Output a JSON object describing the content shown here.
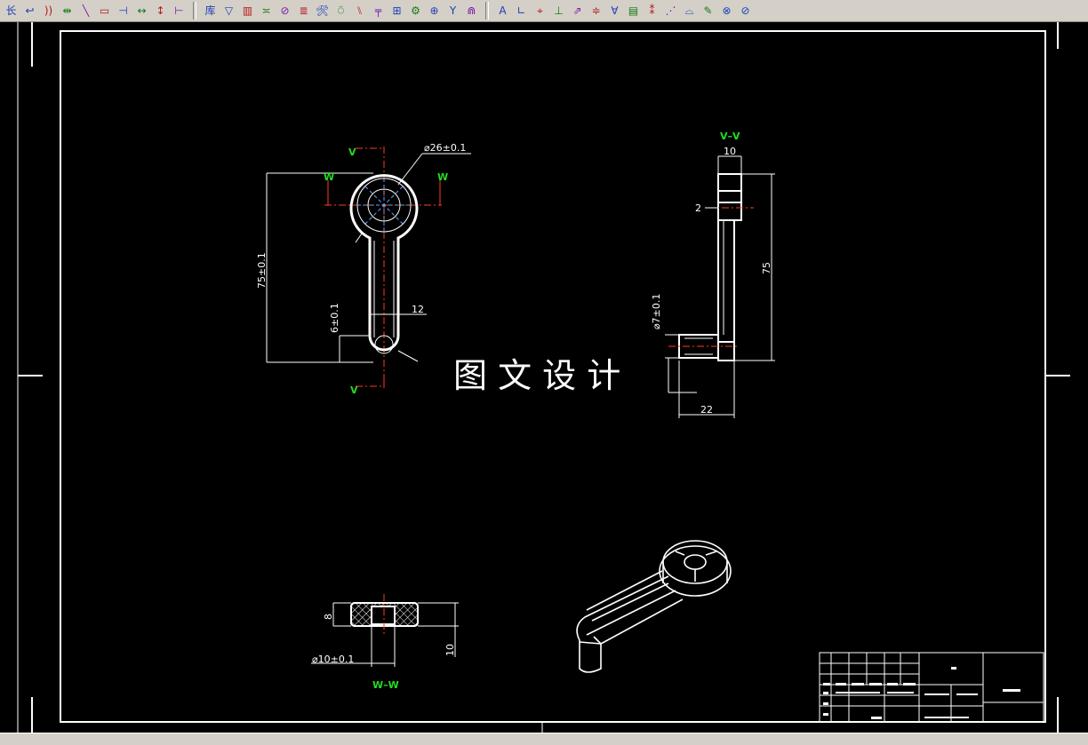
{
  "toolbar": {
    "group1": [
      "长",
      "↩",
      "))",
      "⇹",
      "╲",
      "▭",
      "⊣",
      "↔",
      "↕",
      "⊢"
    ],
    "group2": [
      "库",
      "▽",
      "▥",
      "≍",
      "⊘",
      "≣",
      "🛠",
      "⍥",
      "⑊",
      "╤",
      "⊞",
      "⚙",
      "⊕",
      "Y",
      "⋒"
    ],
    "group3": [
      "A",
      "∟",
      "⌖",
      "⊥",
      "⇗",
      "≑",
      "∀",
      "▤",
      "⁑",
      "⋰",
      "⌓",
      "✎",
      "⊗",
      "⊘"
    ]
  },
  "drawing": {
    "watermark": "图 文 设 计",
    "front_view": {
      "section_mark_top": "V",
      "section_mark_bottom": "V",
      "section_mark_left": "W",
      "section_mark_right": "W",
      "dia_head": "⌀26±0.1",
      "len_overall": "75±0.1",
      "arm_width": "12",
      "dim_6": "6±0.1"
    },
    "side_view": {
      "section_title": "V–V",
      "dim_top": "10",
      "dim_2": "2",
      "dim_75": "75",
      "dia_7": "⌀7±0.1",
      "dim_22": "22"
    },
    "section_view": {
      "section_title": "W–W",
      "dim_8": "8",
      "dim_10": "10",
      "dia_10": "⌀10±0.1"
    }
  },
  "colors": {
    "background": "#000000",
    "lines": "#ffffff",
    "centerlines": "#ff3b1f",
    "section_labels": "#22dd22",
    "hidden": "#5fa8ff",
    "toolbar": "#d4d0c8"
  }
}
